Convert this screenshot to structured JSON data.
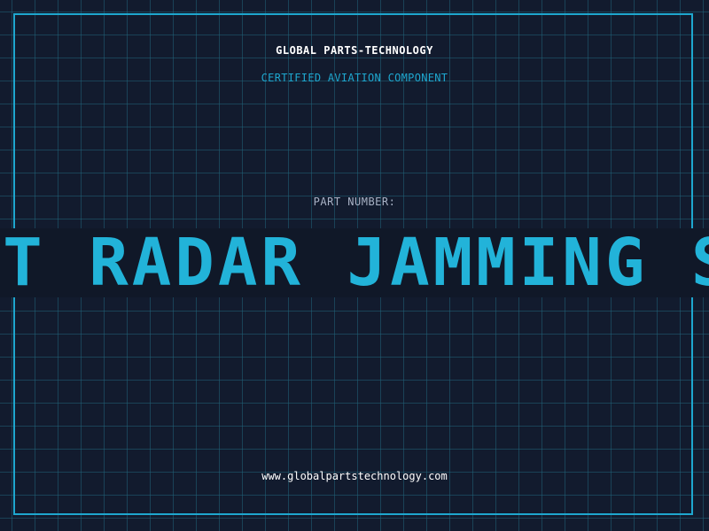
{
  "header": {
    "company": "GLOBAL PARTS-TECHNOLOGY",
    "tagline": "CERTIFIED AVIATION COMPONENT"
  },
  "part": {
    "label": "PART NUMBER:",
    "visible_text": "AFT RADAR JAMMING S"
  },
  "footer": {
    "website": "www.globalpartstechnology.com"
  },
  "colors": {
    "background": "#121b2e",
    "grid": "#206278",
    "accent": "#1ea7cf",
    "heading": "#ffffff",
    "label": "#a9b3c6"
  }
}
